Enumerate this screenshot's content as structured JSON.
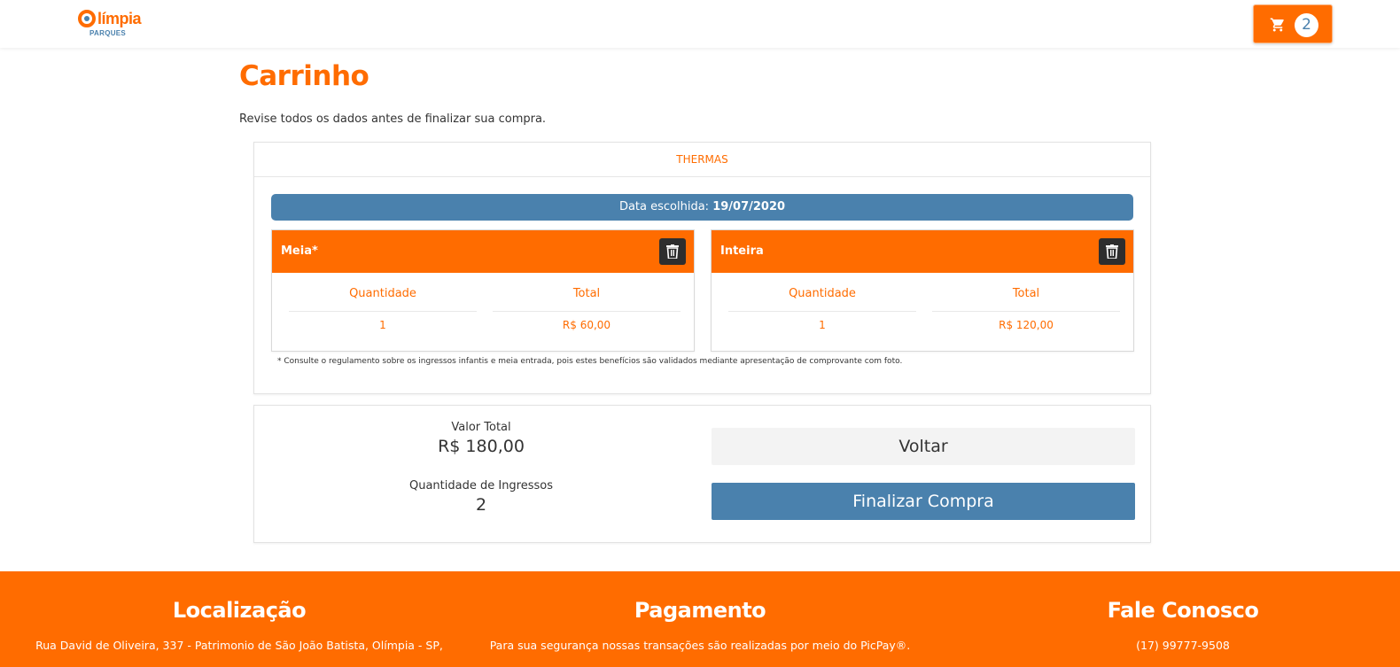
{
  "header": {
    "logo_word": "límpia",
    "logo_sub": "PARQUES",
    "cart_count": "2"
  },
  "page": {
    "title": "Carrinho",
    "subtitle": "Revise todos os dados antes de finalizar sua compra."
  },
  "park": {
    "name": "THERMAS",
    "date_label": "Data escolhida:",
    "date_value": "19/07/2020",
    "tickets": [
      {
        "name": "Meia*",
        "qty_header": "Quantidade",
        "total_header": "Total",
        "qty": "1",
        "total": "R$ 60,00"
      },
      {
        "name": "Inteira",
        "qty_header": "Quantidade",
        "total_header": "Total",
        "qty": "1",
        "total": "R$ 120,00"
      }
    ],
    "footnote": "* Consulte o regulamento sobre os ingressos infantis e meia entrada, pois estes benefícios são validados mediante apresentação de comprovante com foto."
  },
  "summary": {
    "total_label": "Valor Total",
    "total_value": "R$ 180,00",
    "qty_label": "Quantidade de Ingressos",
    "qty_value": "2",
    "back_label": "Voltar",
    "finish_label": "Finalizar Compra"
  },
  "footer": {
    "location_title": "Localização",
    "location_text": "Rua David de Oliveira, 337 - Patrimonio de São João Batista, Olímpia - SP,",
    "payment_title": "Pagamento",
    "payment_text": "Para sua segurança nossas transações são realizadas por meio do PicPay®.",
    "contact_title": "Fale Conosco",
    "contact_text": "(17) 99777-9508"
  },
  "colors": {
    "brand_orange": "#ff6c00",
    "brand_blue": "#4a81ad",
    "dark_button": "#2e2e2e"
  },
  "icons": [
    "cart-icon",
    "trash-icon",
    "logo-ring-icon"
  ]
}
